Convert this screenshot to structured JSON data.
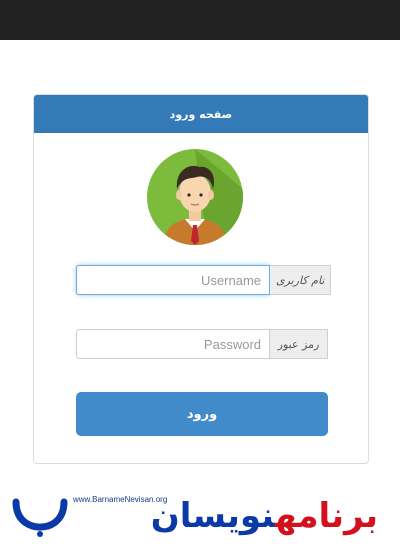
{
  "header": {},
  "login": {
    "title": "صفحه ورود",
    "username_label": "نام کاربری",
    "username_placeholder": "Username",
    "password_label": "رمز عبور",
    "password_placeholder": "Password",
    "submit_label": "ورود"
  },
  "watermark": {
    "url": "www.BarnameNevisan.org",
    "logo_blue": "نویسان",
    "logo_red": "برنامه"
  },
  "colors": {
    "topbar": "#222222",
    "panel_header": "#337ab7",
    "button": "#428bca",
    "logo_blue": "#0b3aa8",
    "logo_red": "#d3101c"
  },
  "icons": [
    "user-avatar-icon"
  ]
}
